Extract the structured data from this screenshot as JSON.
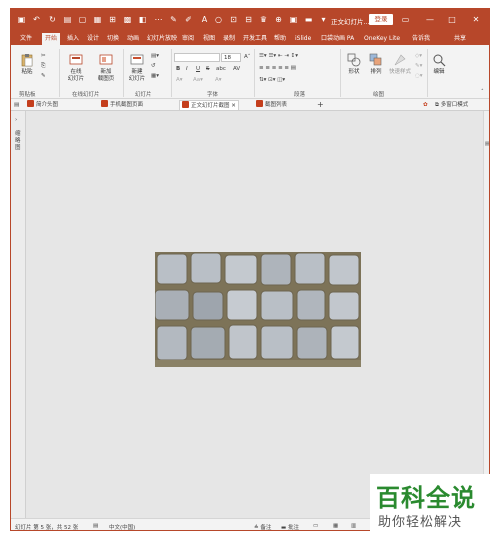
{
  "titlebar": {
    "doc_title": "正文幻灯片...",
    "login_label": "登录",
    "minimize": "—",
    "restore": "□",
    "close": "✕"
  },
  "ribbon_tabs": [
    {
      "label": "文件"
    },
    {
      "label": "开始"
    },
    {
      "label": "插入"
    },
    {
      "label": "设计"
    },
    {
      "label": "切换"
    },
    {
      "label": "动画"
    },
    {
      "label": "幻灯片放映"
    },
    {
      "label": "审阅"
    },
    {
      "label": "视图"
    },
    {
      "label": "录制"
    },
    {
      "label": "开发工具"
    },
    {
      "label": "帮助"
    },
    {
      "label": "iSlide"
    },
    {
      "label": "口袋动画 PA"
    },
    {
      "label": "OneKey Lite"
    },
    {
      "label": "告诉我"
    },
    {
      "label": "共享"
    }
  ],
  "ribbon": {
    "paste_label": "粘贴",
    "clipboard_group": "剪贴板",
    "online_slides_label": "在线\n幻灯片",
    "new_slide_from_online_label": "新加\n载图页",
    "online_group": "在线幻灯片",
    "new_slide_label": "新建\n幻灯片",
    "slides_group": "幻灯片",
    "font_size": "18",
    "font_group": "字体",
    "paragraph_group": "段落",
    "shape_label": "形状",
    "arrange_label": "排列",
    "quickstyle_label": "快速样式",
    "drawing_group": "绘图",
    "edit_label": "编辑",
    "bold": "B",
    "italic": "I",
    "underline": "U",
    "strike": "S",
    "abc": "abc"
  },
  "doc_tabs": [
    {
      "label": "简介头图"
    },
    {
      "label": "手机截图页面"
    },
    {
      "label": "正文幻灯片截图"
    },
    {
      "label": "截图列表"
    },
    {
      "label": "多窗口模式"
    }
  ],
  "left_panel_label": "缩略图",
  "status": {
    "slide_info": "幻灯片 第 5 张，共 52 张",
    "language": "中文(中国)",
    "notes": "备注",
    "comments": "批注"
  },
  "watermark": {
    "top": "百科全说",
    "bottom": "助你轻松解决"
  },
  "colors": {
    "brand": "#b7472a",
    "watermark_green": "#2a8a2f"
  }
}
